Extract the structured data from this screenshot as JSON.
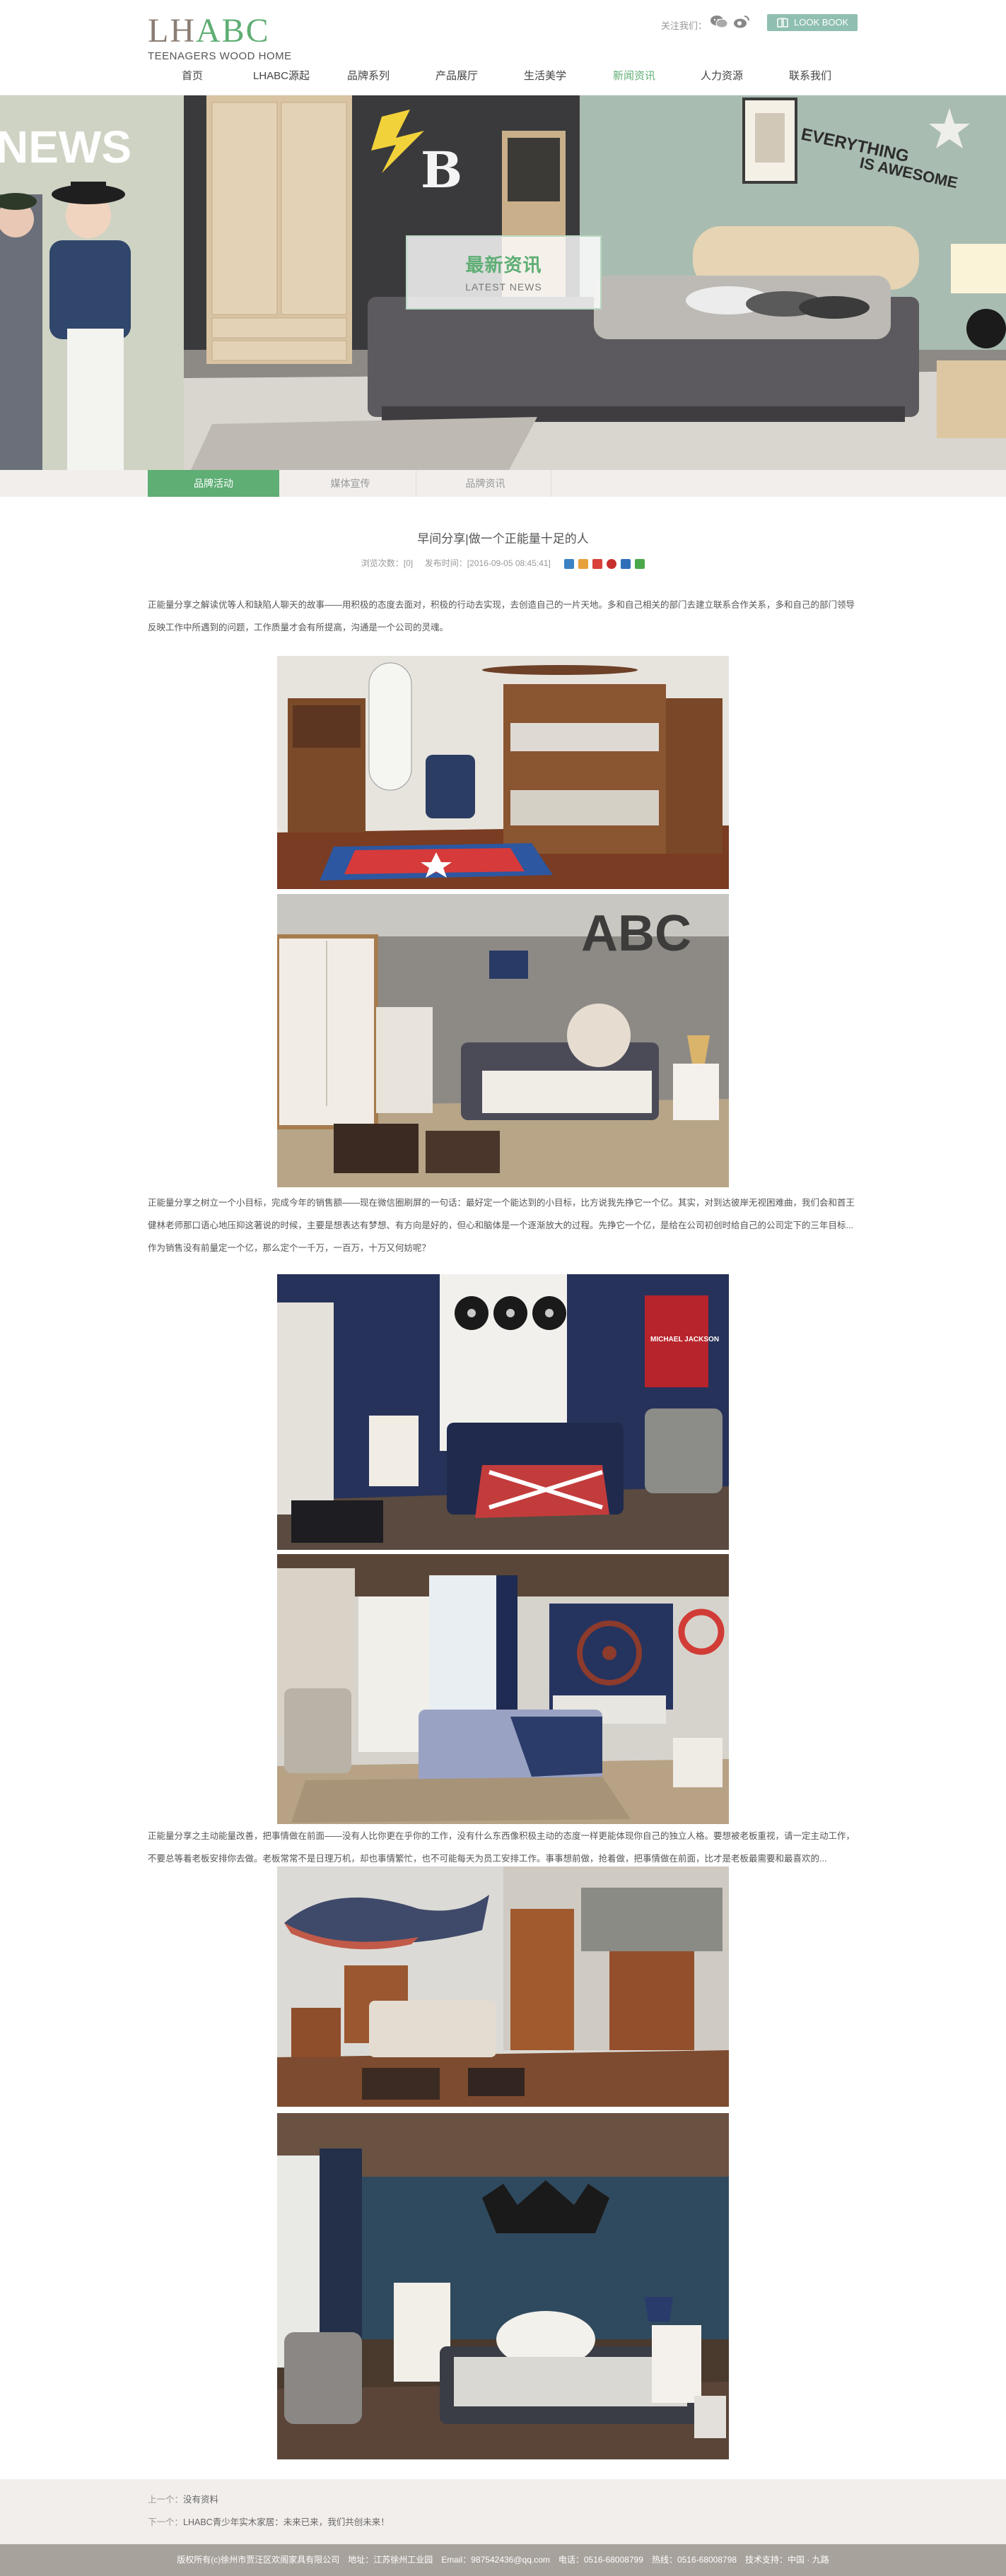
{
  "header": {
    "logo_letters_1": "LH",
    "logo_letters_2": "ABC",
    "logo_subtitle": "TEENAGERS WOOD HOME",
    "follow_label": "关注我们：",
    "lookbook_label": "LOOK BOOK"
  },
  "nav": {
    "items": [
      {
        "label": "首页"
      },
      {
        "label": "LHABC源起"
      },
      {
        "label": "品牌系列"
      },
      {
        "label": "产品展厅"
      },
      {
        "label": "生活美学"
      },
      {
        "label": "新闻资讯"
      },
      {
        "label": "人力资源"
      },
      {
        "label": "联系我们"
      }
    ],
    "active_index": 5
  },
  "hero": {
    "title_cn": "最新资讯",
    "title_en": "LATEST NEWS",
    "partial_word": "NEWS",
    "wall_text_1": "EVERYTHING",
    "wall_text_2": "IS AWESOME",
    "wall_letter": "B"
  },
  "subnav": {
    "tabs": [
      {
        "label": "品牌活动"
      },
      {
        "label": "媒体宣传"
      },
      {
        "label": "品牌资讯"
      }
    ],
    "active_index": 0
  },
  "article": {
    "title": "早间分享|做一个正能量十足的人",
    "views_label": "浏览次数：",
    "views": "[0]",
    "date_label": "发布时间：",
    "date": "[2016-09-05 08:45:41]",
    "paragraph_1": "正能量分享之解读优等人和缺陷人聊天的故事——用积极的态度去面对，积极的行动去实现，去创造自己的一片天地。多和自己相关的部门去建立联系合作关系，多和自己的部门领导反映工作中所遇到的问题，工作质量才会有所提高，沟通是一个公司的灵魂。",
    "paragraph_2": "正能量分享之树立一个小目标，完成今年的销售额——现在微信圈刷屏的一句话：最好定一个能达到的小目标，比方说我先挣它一个亿。其实，对到达彼岸无视困难曲，我们会和首王健林老师那口语心地压抑这著说的时候，主要是想表达有梦想、有方向是好的，但心和脑体是一个逐渐放大的过程。先挣它一个亿，是给在公司初创时给自己的公司定下的三年目标...作为销售没有前量定一个亿，那么定个一千万，一百万，十万又何妨呢？",
    "paragraph_3": "正能量分享之主动能量改善，把事情做在前面——没有人比你更在乎你的工作，没有什么东西像积极主动的态度一样更能体现你自己的独立人格。要想被老板重视，请一定主动工作，不要总等着老板安排你去做。老板常常不是日理万机，却也事情繁忙，也不可能每天为员工安排工作。事事想前做，抢着做，把事情做在前面，比才是老板最需要和最喜欢的..."
  },
  "photo_labels": {
    "photo_3_record_text": "MICHAEL JACKSON",
    "photo_2_letters": "ABC"
  },
  "prevnext": {
    "prev_label": "上一个：",
    "prev_title": "没有资料",
    "next_label": "下一个：",
    "next_title": "LHABC青少年实木家居：未来已来，我们共创未来！"
  },
  "footer": {
    "text": "版权所有(c)徐州市贾汪区欢阁家具有限公司　地址：江苏徐州工业园　Email：987542436@qq.com　电话：0516-68008799　热线：0516-68008798　技术支持：中国 · 九路"
  },
  "colors": {
    "accent_green": "#5fae74",
    "lookbook_teal": "#8fbfb0",
    "subnav_bg": "#f2eeeb",
    "footer_bg": "#a8a29c"
  }
}
